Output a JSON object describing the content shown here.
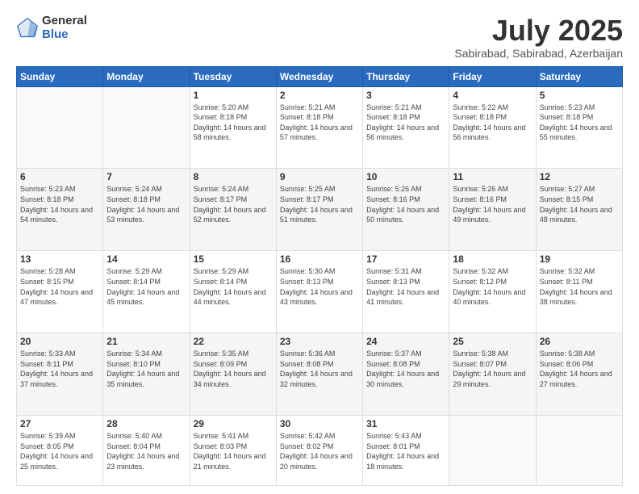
{
  "logo": {
    "general": "General",
    "blue": "Blue"
  },
  "header": {
    "month": "July 2025",
    "location": "Sabirabad, Sabirabad, Azerbaijan"
  },
  "weekdays": [
    "Sunday",
    "Monday",
    "Tuesday",
    "Wednesday",
    "Thursday",
    "Friday",
    "Saturday"
  ],
  "weeks": [
    [
      {
        "day": "",
        "sunrise": "",
        "sunset": "",
        "daylight": ""
      },
      {
        "day": "",
        "sunrise": "",
        "sunset": "",
        "daylight": ""
      },
      {
        "day": "1",
        "sunrise": "Sunrise: 5:20 AM",
        "sunset": "Sunset: 8:18 PM",
        "daylight": "Daylight: 14 hours and 58 minutes."
      },
      {
        "day": "2",
        "sunrise": "Sunrise: 5:21 AM",
        "sunset": "Sunset: 8:18 PM",
        "daylight": "Daylight: 14 hours and 57 minutes."
      },
      {
        "day": "3",
        "sunrise": "Sunrise: 5:21 AM",
        "sunset": "Sunset: 8:18 PM",
        "daylight": "Daylight: 14 hours and 56 minutes."
      },
      {
        "day": "4",
        "sunrise": "Sunrise: 5:22 AM",
        "sunset": "Sunset: 8:18 PM",
        "daylight": "Daylight: 14 hours and 56 minutes."
      },
      {
        "day": "5",
        "sunrise": "Sunrise: 5:23 AM",
        "sunset": "Sunset: 8:18 PM",
        "daylight": "Daylight: 14 hours and 55 minutes."
      }
    ],
    [
      {
        "day": "6",
        "sunrise": "Sunrise: 5:23 AM",
        "sunset": "Sunset: 8:18 PM",
        "daylight": "Daylight: 14 hours and 54 minutes."
      },
      {
        "day": "7",
        "sunrise": "Sunrise: 5:24 AM",
        "sunset": "Sunset: 8:18 PM",
        "daylight": "Daylight: 14 hours and 53 minutes."
      },
      {
        "day": "8",
        "sunrise": "Sunrise: 5:24 AM",
        "sunset": "Sunset: 8:17 PM",
        "daylight": "Daylight: 14 hours and 52 minutes."
      },
      {
        "day": "9",
        "sunrise": "Sunrise: 5:25 AM",
        "sunset": "Sunset: 8:17 PM",
        "daylight": "Daylight: 14 hours and 51 minutes."
      },
      {
        "day": "10",
        "sunrise": "Sunrise: 5:26 AM",
        "sunset": "Sunset: 8:16 PM",
        "daylight": "Daylight: 14 hours and 50 minutes."
      },
      {
        "day": "11",
        "sunrise": "Sunrise: 5:26 AM",
        "sunset": "Sunset: 8:16 PM",
        "daylight": "Daylight: 14 hours and 49 minutes."
      },
      {
        "day": "12",
        "sunrise": "Sunrise: 5:27 AM",
        "sunset": "Sunset: 8:15 PM",
        "daylight": "Daylight: 14 hours and 48 minutes."
      }
    ],
    [
      {
        "day": "13",
        "sunrise": "Sunrise: 5:28 AM",
        "sunset": "Sunset: 8:15 PM",
        "daylight": "Daylight: 14 hours and 47 minutes."
      },
      {
        "day": "14",
        "sunrise": "Sunrise: 5:29 AM",
        "sunset": "Sunset: 8:14 PM",
        "daylight": "Daylight: 14 hours and 45 minutes."
      },
      {
        "day": "15",
        "sunrise": "Sunrise: 5:29 AM",
        "sunset": "Sunset: 8:14 PM",
        "daylight": "Daylight: 14 hours and 44 minutes."
      },
      {
        "day": "16",
        "sunrise": "Sunrise: 5:30 AM",
        "sunset": "Sunset: 8:13 PM",
        "daylight": "Daylight: 14 hours and 43 minutes."
      },
      {
        "day": "17",
        "sunrise": "Sunrise: 5:31 AM",
        "sunset": "Sunset: 8:13 PM",
        "daylight": "Daylight: 14 hours and 41 minutes."
      },
      {
        "day": "18",
        "sunrise": "Sunrise: 5:32 AM",
        "sunset": "Sunset: 8:12 PM",
        "daylight": "Daylight: 14 hours and 40 minutes."
      },
      {
        "day": "19",
        "sunrise": "Sunrise: 5:32 AM",
        "sunset": "Sunset: 8:11 PM",
        "daylight": "Daylight: 14 hours and 38 minutes."
      }
    ],
    [
      {
        "day": "20",
        "sunrise": "Sunrise: 5:33 AM",
        "sunset": "Sunset: 8:11 PM",
        "daylight": "Daylight: 14 hours and 37 minutes."
      },
      {
        "day": "21",
        "sunrise": "Sunrise: 5:34 AM",
        "sunset": "Sunset: 8:10 PM",
        "daylight": "Daylight: 14 hours and 35 minutes."
      },
      {
        "day": "22",
        "sunrise": "Sunrise: 5:35 AM",
        "sunset": "Sunset: 8:09 PM",
        "daylight": "Daylight: 14 hours and 34 minutes."
      },
      {
        "day": "23",
        "sunrise": "Sunrise: 5:36 AM",
        "sunset": "Sunset: 8:08 PM",
        "daylight": "Daylight: 14 hours and 32 minutes."
      },
      {
        "day": "24",
        "sunrise": "Sunrise: 5:37 AM",
        "sunset": "Sunset: 8:08 PM",
        "daylight": "Daylight: 14 hours and 30 minutes."
      },
      {
        "day": "25",
        "sunrise": "Sunrise: 5:38 AM",
        "sunset": "Sunset: 8:07 PM",
        "daylight": "Daylight: 14 hours and 29 minutes."
      },
      {
        "day": "26",
        "sunrise": "Sunrise: 5:38 AM",
        "sunset": "Sunset: 8:06 PM",
        "daylight": "Daylight: 14 hours and 27 minutes."
      }
    ],
    [
      {
        "day": "27",
        "sunrise": "Sunrise: 5:39 AM",
        "sunset": "Sunset: 8:05 PM",
        "daylight": "Daylight: 14 hours and 25 minutes."
      },
      {
        "day": "28",
        "sunrise": "Sunrise: 5:40 AM",
        "sunset": "Sunset: 8:04 PM",
        "daylight": "Daylight: 14 hours and 23 minutes."
      },
      {
        "day": "29",
        "sunrise": "Sunrise: 5:41 AM",
        "sunset": "Sunset: 8:03 PM",
        "daylight": "Daylight: 14 hours and 21 minutes."
      },
      {
        "day": "30",
        "sunrise": "Sunrise: 5:42 AM",
        "sunset": "Sunset: 8:02 PM",
        "daylight": "Daylight: 14 hours and 20 minutes."
      },
      {
        "day": "31",
        "sunrise": "Sunrise: 5:43 AM",
        "sunset": "Sunset: 8:01 PM",
        "daylight": "Daylight: 14 hours and 18 minutes."
      },
      {
        "day": "",
        "sunrise": "",
        "sunset": "",
        "daylight": ""
      },
      {
        "day": "",
        "sunrise": "",
        "sunset": "",
        "daylight": ""
      }
    ]
  ]
}
